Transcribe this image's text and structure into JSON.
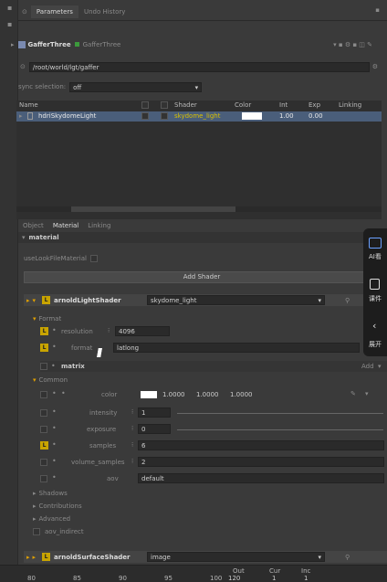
{
  "tabs": {
    "parameters": "Parameters",
    "undo_history": "Undo History"
  },
  "node": {
    "name": "GafferThree",
    "type": "GafferThree"
  },
  "path": "/root/world/lgt/gaffer",
  "sync": {
    "label": "sync selection:",
    "value": "off"
  },
  "table": {
    "headers": [
      "Name",
      "Shader",
      "Color",
      "Int",
      "Exp",
      "Linking"
    ],
    "row": {
      "name": "hdriSkydomeLight",
      "shader": "skydome_light",
      "int": "1.00",
      "exp": "0.00"
    }
  },
  "subtabs": {
    "object": "Object",
    "material": "Material",
    "linking": "Linking"
  },
  "material": {
    "header": "material",
    "use_look_file": "useLookFileMaterial",
    "add_shader": "Add Shader",
    "light_shader": {
      "label": "arnoldLightShader",
      "value": "skydome_light",
      "format_group": "Format",
      "resolution_label": "resolution",
      "resolution": "4096",
      "format_label": "format",
      "format_value": "latlong",
      "matrix_label": "matrix",
      "add_label": "Add",
      "common_group": "Common",
      "color_label": "color",
      "color_values": [
        "1.0000",
        "1.0000",
        "1.0000"
      ],
      "intensity_label": "intensity",
      "intensity": "1",
      "exposure_label": "exposure",
      "exposure": "0",
      "samples_label": "samples",
      "samples": "6",
      "volume_samples_label": "volume_samples",
      "volume_samples": "2",
      "aov_label": "aov",
      "aov": "default",
      "shadows": "Shadows",
      "contributions": "Contributions",
      "advanced": "Advanced",
      "aov_indirect": "aov_indirect"
    },
    "surface_shader": {
      "label": "arnoldSurfaceShader",
      "value": "image"
    }
  },
  "timeline": {
    "labels": [
      "Out",
      "Cur",
      "Inc"
    ],
    "ticks": [
      "80",
      "85",
      "90",
      "95",
      "100"
    ],
    "values": [
      "120",
      "1",
      "1"
    ]
  },
  "side_panel": {
    "ai": "AI看",
    "course": "课件",
    "expand": "展开"
  },
  "colors": {
    "bg": "#3a3a3a",
    "panel": "#2f2f2f",
    "selected_row": "#4a5e7a",
    "accent_yellow": "#d8c000",
    "lock_yellow": "#c8a400",
    "side_panel_bg": "#1d1d1d"
  }
}
